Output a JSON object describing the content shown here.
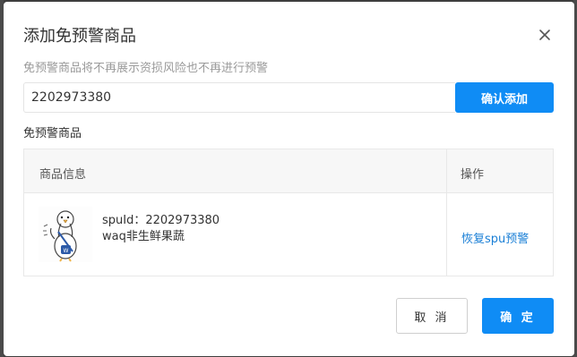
{
  "dialog": {
    "title": "添加免预警商品",
    "subtitle": "免预警商品将不再展示资损风险也不再进行预警"
  },
  "add_form": {
    "input_value": "2202973380",
    "add_button": "确认添加"
  },
  "list": {
    "section_label": "免预警商品",
    "columns": [
      "商品信息",
      "操作"
    ],
    "rows": [
      {
        "spu_text": "spuId：2202973380",
        "product_name": "waq非生鲜果蔬",
        "action": "恢复spu预警",
        "thumbnail_icon": "duck-mascot-icon"
      }
    ]
  },
  "footer": {
    "cancel_label": "取 消",
    "ok_label": "确 定"
  },
  "colors": {
    "primary": "#0f8cf5",
    "link": "#1a7fd6",
    "muted": "#9a9a9a"
  }
}
